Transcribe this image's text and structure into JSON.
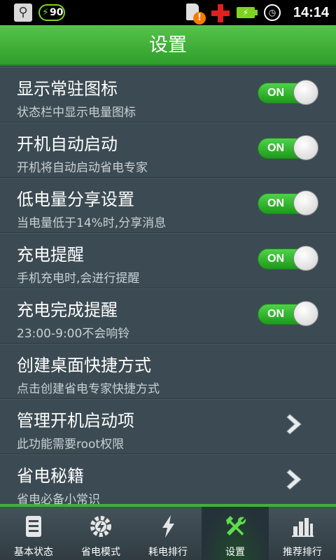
{
  "status_bar": {
    "battery_percent": "90",
    "time": "14:14"
  },
  "header": {
    "title": "设置"
  },
  "settings": [
    {
      "label": "显示常驻图标",
      "sub": "状态栏中显示电量图标",
      "control": "toggle",
      "state": "ON"
    },
    {
      "label": "开机自动启动",
      "sub": "开机将自动启动省电专家",
      "control": "toggle",
      "state": "ON"
    },
    {
      "label": "低电量分享设置",
      "sub": "当电量低于14%时,分享消息",
      "control": "toggle",
      "state": "ON"
    },
    {
      "label": "充电提醒",
      "sub": "手机充电时,会进行提醒",
      "control": "toggle",
      "state": "ON"
    },
    {
      "label": "充电完成提醒",
      "sub": "23:00-9:00不会响铃",
      "control": "toggle",
      "state": "ON"
    },
    {
      "label": "创建桌面快捷方式",
      "sub": "点击创建省电专家快捷方式",
      "control": "none"
    },
    {
      "label": "管理开机启动项",
      "sub": "此功能需要root权限",
      "control": "chevron"
    },
    {
      "label": "省电秘籍",
      "sub": "省电必备小常识",
      "control": "chevron"
    }
  ],
  "bottom_nav": [
    {
      "label": "基本状态",
      "icon": "document-icon"
    },
    {
      "label": "省电模式",
      "icon": "gear-bolt-icon"
    },
    {
      "label": "耗电排行",
      "icon": "lightning-icon"
    },
    {
      "label": "设置",
      "icon": "tools-icon",
      "active": true
    },
    {
      "label": "推荐排行",
      "icon": "bar-chart-icon"
    }
  ],
  "colors": {
    "accent_green": "#3fb13a",
    "background": "#3c4b53"
  }
}
